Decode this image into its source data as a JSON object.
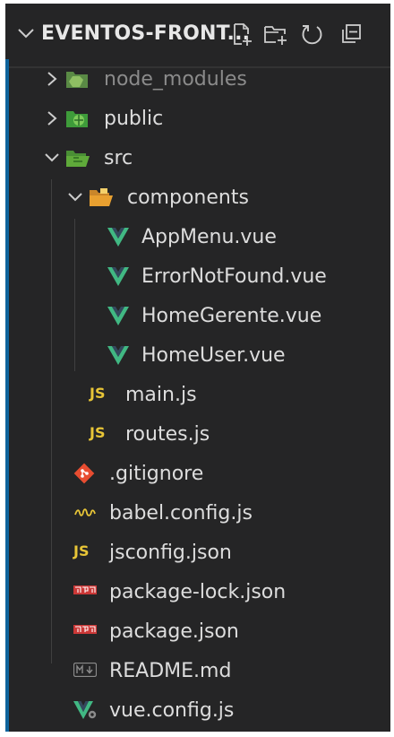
{
  "explorer": {
    "title": "EVENTOS-FRONT...",
    "actions": {
      "new_file": "new-file-icon",
      "new_folder": "new-folder-icon",
      "refresh": "refresh-icon",
      "collapse": "collapse-all-icon"
    }
  },
  "tree": {
    "node_modules": "node_modules",
    "public": "public",
    "src": "src",
    "components": "components",
    "appmenu": "AppMenu.vue",
    "errornotfound": "ErrorNotFound.vue",
    "homegerente": "HomeGerente.vue",
    "homeuser": "HomeUser.vue",
    "mainjs": "main.js",
    "routesjs": "routes.js",
    "gitignore": ".gitignore",
    "babel": "babel.config.js",
    "jsconfig": "jsconfig.json",
    "packagelock": "package-lock.json",
    "package": "package.json",
    "readme": "README.md",
    "vueconfig": "vue.config.js",
    "js_badge": "JS"
  },
  "colors": {
    "background": "#252526",
    "text": "#dddddd",
    "dim_text": "#8b8b8b",
    "js": "#e8c537",
    "vue_green": "#41b883",
    "npm_red": "#cb3837",
    "git_red": "#e84d31",
    "folder_green": "#5faa3a",
    "folder_orange": "#e8a030"
  }
}
